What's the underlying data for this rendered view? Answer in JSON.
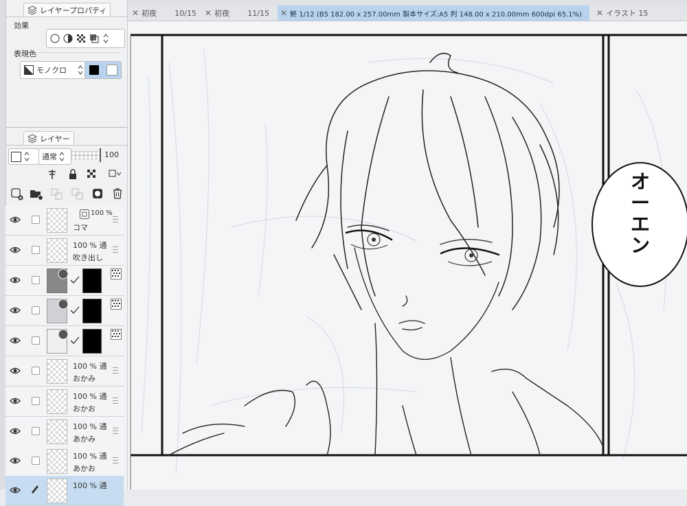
{
  "properties_panel": {
    "tab_label": "レイヤープロパティ",
    "effect_label": "効果",
    "expression_color_label": "表現色",
    "expression_color_value": "モノクロ"
  },
  "layer_panel": {
    "tab_label": "レイヤー",
    "blend_mode": "通常",
    "opacity": "100",
    "layers": [
      {
        "percent": "100 %",
        "name": "コマ",
        "selected": false
      },
      {
        "percent": "100 % 通",
        "name": "吹き出し",
        "selected": false
      },
      {
        "percent": "",
        "name": "",
        "selected": false
      },
      {
        "percent": "",
        "name": "",
        "selected": false
      },
      {
        "percent": "",
        "name": "",
        "selected": false
      },
      {
        "percent": "100 % 通",
        "name": "おかみ",
        "selected": false
      },
      {
        "percent": "100 % 通",
        "name": "おかお",
        "selected": false
      },
      {
        "percent": "100 % 通",
        "name": "あかみ",
        "selected": false
      },
      {
        "percent": "100 % 通",
        "name": "あかお",
        "selected": false
      },
      {
        "percent": "100 % 通",
        "name": "",
        "selected": true
      }
    ]
  },
  "document_tabs": [
    {
      "name": "初夜",
      "count": "10/15",
      "active": false
    },
    {
      "name": "初夜",
      "count": "11/15",
      "active": false
    },
    {
      "name": "鮗 1/12 (B5 182.00 x 257.00mm 製本サイズ:A5 判 148.00 x 210.00mm 600dpi 65.1%)",
      "count": "",
      "active": true
    },
    {
      "name": "イラスト 15",
      "count": "",
      "active": false
    }
  ],
  "canvas": {
    "speech_text": "オーエン"
  },
  "colors": {
    "panel_bg": "#f0f1f2",
    "selected_layer": "#c7dcf0",
    "active_tab": "#b9d3ee"
  }
}
